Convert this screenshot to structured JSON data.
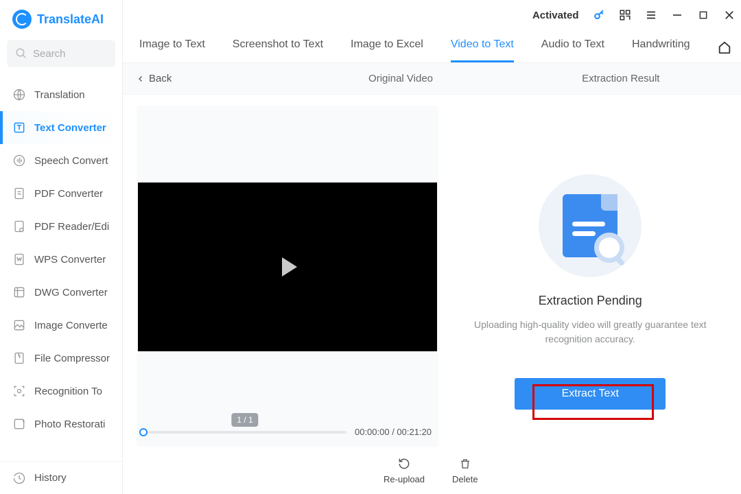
{
  "brand": {
    "title": "TranslateAI"
  },
  "search": {
    "placeholder": "Search"
  },
  "sidebar": {
    "items": [
      {
        "label": "Translation"
      },
      {
        "label": "Text Converter"
      },
      {
        "label": "Speech Convert"
      },
      {
        "label": "PDF Converter"
      },
      {
        "label": "PDF Reader/Edi"
      },
      {
        "label": "WPS Converter"
      },
      {
        "label": "DWG Converter"
      },
      {
        "label": "Image Converte"
      },
      {
        "label": "File Compressor"
      },
      {
        "label": "Recognition To"
      },
      {
        "label": "Photo Restorati"
      }
    ],
    "history_label": "History"
  },
  "titlebar": {
    "activated": "Activated"
  },
  "tabs": {
    "items": [
      {
        "label": "Image to Text"
      },
      {
        "label": "Screenshot to Text"
      },
      {
        "label": "Image to Excel"
      },
      {
        "label": "Video to Text"
      },
      {
        "label": "Audio to Text"
      },
      {
        "label": "Handwriting"
      }
    ],
    "active_index": 3
  },
  "subheader": {
    "back": "Back",
    "left_label": "Original Video",
    "right_label": "Extraction Result"
  },
  "video": {
    "count_badge": "1 / 1",
    "time": "00:00:00 / 00:21:20"
  },
  "result": {
    "title": "Extraction Pending",
    "description": "Uploading high-quality video will greatly guarantee text recognition accuracy.",
    "button": "Extract Text"
  },
  "actions": {
    "reupload": "Re-upload",
    "delete": "Delete"
  }
}
